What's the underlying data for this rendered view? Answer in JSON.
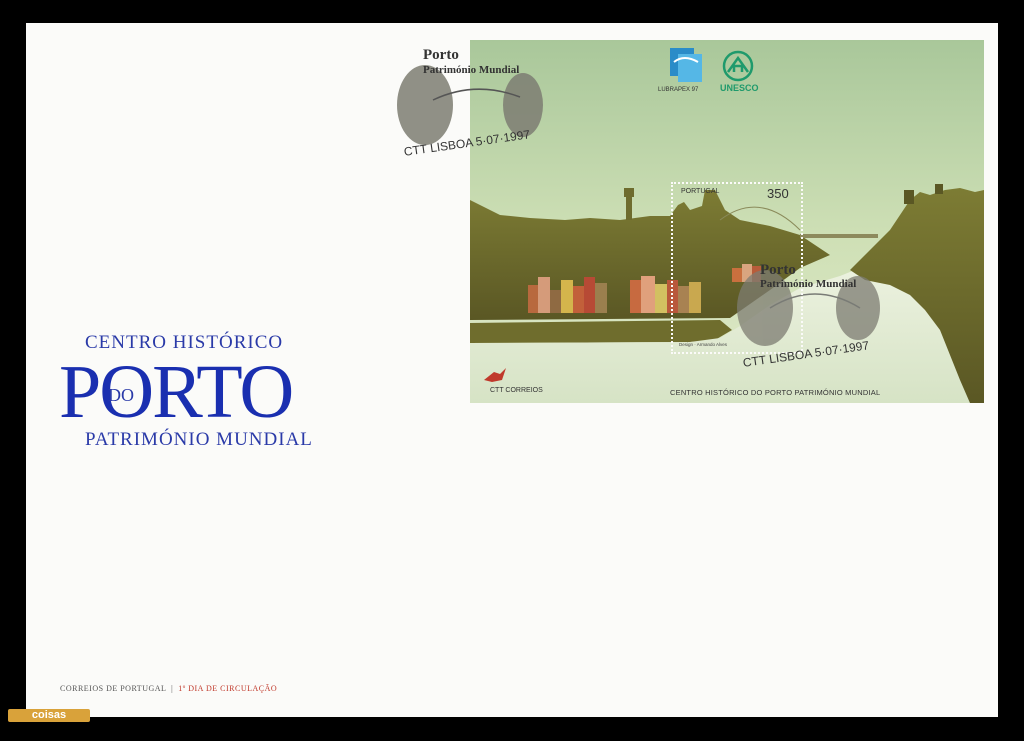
{
  "cover": {
    "title_line1": "CENTRO HISTÓRICO",
    "title_do": "DO",
    "title_main": "PORTO",
    "title_line3": "PATRIMÓNIO        MUNDIAL",
    "footer_left": "CORREIOS DE PORTUGAL",
    "footer_right": "1º DIA DE CIRCULAÇÃO"
  },
  "sheet": {
    "caption": "CENTRO HISTÓRICO DO PORTO PATRIMÓNIO MUNDIAL",
    "lubrapex_label": "LUBRAPEX 97",
    "unesco_label": "UNESCO",
    "ctt_label": "CTT CORREIOS"
  },
  "stamp": {
    "country": "PORTUGAL",
    "value": "350",
    "design_credit": "Design · Armando Alves"
  },
  "postmark": {
    "title": "Porto",
    "subtitle": "Património Mundial",
    "date_line": "CTT LISBOA 5·07·1997"
  },
  "watermark": "coisas",
  "colors": {
    "title_blue": "#1a2fb0",
    "sky_green": "#c9dcb4",
    "land_olive": "#6c6a2a",
    "unesco_green": "#1f9a6c",
    "lubrapex_blue": "#2a8cc8"
  }
}
